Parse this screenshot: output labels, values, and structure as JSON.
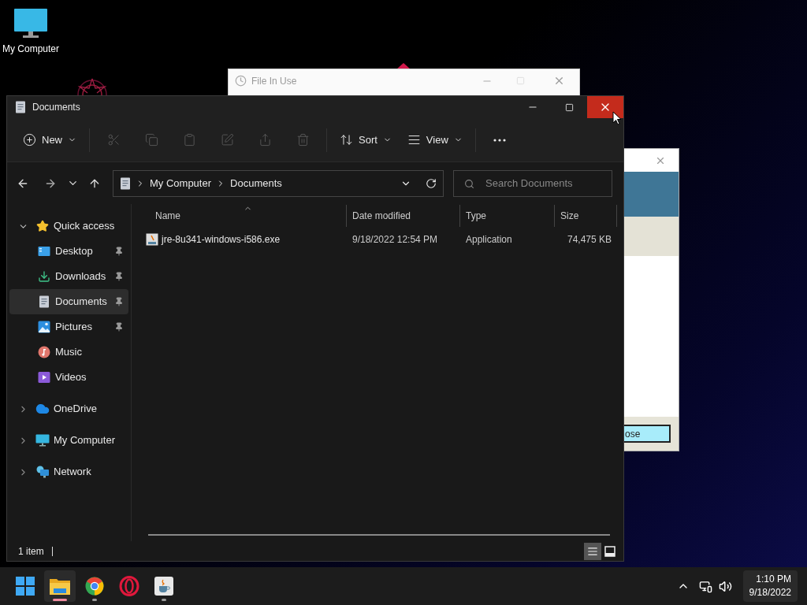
{
  "desktop_icons": [
    {
      "label": "My Computer"
    }
  ],
  "background_window": {
    "title": "File In Use"
  },
  "partial_dialog": {
    "button": "ose"
  },
  "explorer": {
    "title": "Documents",
    "toolbar": [
      {
        "kind": "new",
        "label": "New",
        "disabled": false
      },
      {
        "kind": "cut",
        "disabled": true
      },
      {
        "kind": "copy",
        "disabled": true
      },
      {
        "kind": "paste",
        "disabled": true
      },
      {
        "kind": "rename",
        "disabled": true
      },
      {
        "kind": "share",
        "disabled": true
      },
      {
        "kind": "delete",
        "disabled": true
      },
      {
        "kind": "sort",
        "label": "Sort",
        "disabled": false
      },
      {
        "kind": "view",
        "label": "View",
        "disabled": false
      },
      {
        "kind": "more",
        "disabled": false
      }
    ],
    "breadcrumb": [
      "My Computer",
      "Documents"
    ],
    "search": {
      "placeholder": "Search Documents"
    },
    "sidebar": [
      {
        "kind": "star",
        "label": "Quick access",
        "expanded": true,
        "selected": false,
        "children": [
          {
            "kind": "desktop",
            "label": "Desktop",
            "pinned": true,
            "selected": false
          },
          {
            "kind": "downloads",
            "label": "Downloads",
            "pinned": true,
            "selected": false
          },
          {
            "kind": "documents",
            "label": "Documents",
            "pinned": true,
            "selected": true
          },
          {
            "kind": "pictures",
            "label": "Pictures",
            "pinned": true,
            "selected": false
          },
          {
            "kind": "music",
            "label": "Music",
            "pinned": false,
            "selected": false
          },
          {
            "kind": "videos",
            "label": "Videos",
            "pinned": false,
            "selected": false
          }
        ]
      },
      {
        "kind": "cloud",
        "label": "OneDrive",
        "expanded": false,
        "selected": false
      },
      {
        "kind": "computer",
        "label": "My Computer",
        "expanded": false,
        "selected": false
      },
      {
        "kind": "network",
        "label": "Network",
        "expanded": false,
        "selected": false
      }
    ],
    "columns": [
      "Name",
      "Date modified",
      "Type",
      "Size"
    ],
    "rows": [
      {
        "name": "jre-8u341-windows-i586.exe",
        "date": "9/18/2022 12:54 PM",
        "type": "Application",
        "size": "74,475 KB"
      }
    ],
    "status": "1 item",
    "view_modes": [
      {
        "kind": "details",
        "selected": true
      },
      {
        "kind": "tiles",
        "selected": false
      }
    ]
  },
  "taskbar": {
    "apps": [
      {
        "kind": "start",
        "running": false,
        "active": false
      },
      {
        "kind": "explorer",
        "running": true,
        "active": true
      },
      {
        "kind": "chrome",
        "running": true,
        "active": false
      },
      {
        "kind": "opera",
        "running": false,
        "active": false
      },
      {
        "kind": "java",
        "running": true,
        "active": false
      }
    ],
    "time": "1:10 PM",
    "date": "9/18/2022"
  }
}
